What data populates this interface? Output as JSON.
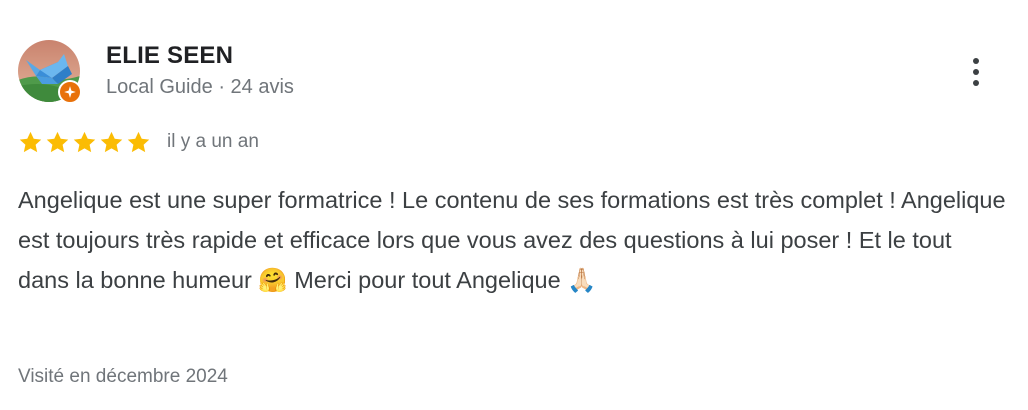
{
  "reviewer": {
    "name": "ELIE SEEN",
    "role": "Local Guide",
    "separator": "·",
    "review_count": "24 avis",
    "avatar_icon": "origami-crane-avatar",
    "badge_icon": "local-guide-star-badge"
  },
  "menu": {
    "icon": "more-vertical-icon"
  },
  "rating": {
    "stars": 5,
    "max_stars": 5,
    "star_color": "#fbbc04",
    "date": "il y a un an"
  },
  "review": {
    "text_part1": "Angelique est une super formatrice ! Le contenu de ses formations est très complet ! Angelique est toujours très rapide et efficace lors que vous avez des questions à lui poser ! Et le tout dans la bonne humeur ",
    "emoji1": "🤗",
    "text_part2": " Merci pour tout Angelique ",
    "emoji2": "🙏🏻"
  },
  "visit": {
    "text": "Visité en décembre 2024"
  },
  "colors": {
    "name": "#202124",
    "secondary": "#70757a",
    "body": "#3c4043",
    "badge": "#e8710a"
  }
}
